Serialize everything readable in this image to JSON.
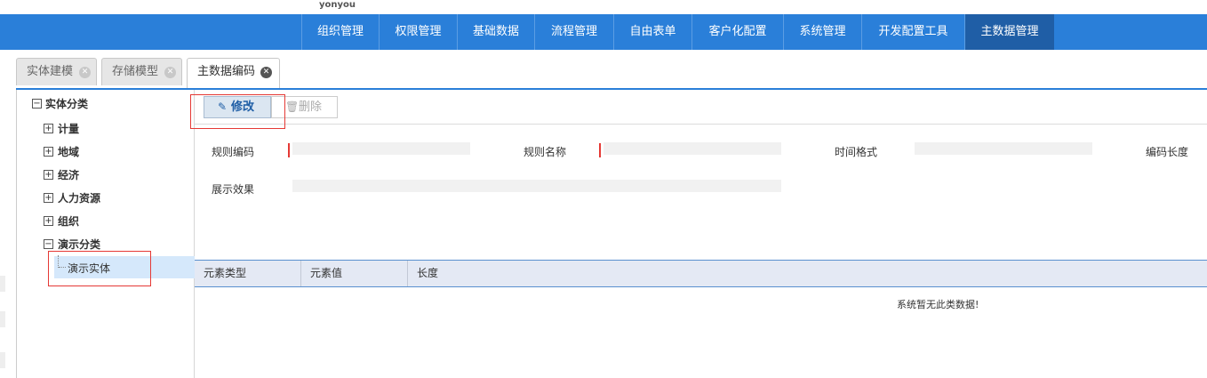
{
  "brand": {
    "logo_text": "yonyou"
  },
  "nav": {
    "items": [
      {
        "label": "组织管理"
      },
      {
        "label": "权限管理"
      },
      {
        "label": "基础数据"
      },
      {
        "label": "流程管理"
      },
      {
        "label": "自由表单"
      },
      {
        "label": "客户化配置"
      },
      {
        "label": "系统管理"
      },
      {
        "label": "开发配置工具"
      },
      {
        "label": "主数据管理",
        "active": true
      }
    ],
    "color": "#2a7fd9",
    "active_color": "#1f5ea6"
  },
  "tabs": [
    {
      "label": "实体建模",
      "close_icon": "close-circle-icon"
    },
    {
      "label": "存储模型",
      "close_icon": "close-circle-icon"
    },
    {
      "label": "主数据编码",
      "close_icon": "close-circle-icon",
      "active": true
    }
  ],
  "tree": {
    "root": {
      "label": "实体分类",
      "toggle": "−"
    },
    "nodes": [
      {
        "label": "计量",
        "toggle": "+"
      },
      {
        "label": "地域",
        "toggle": "+"
      },
      {
        "label": "经济",
        "toggle": "+"
      },
      {
        "label": "人力资源",
        "toggle": "+"
      },
      {
        "label": "组织",
        "toggle": "+"
      },
      {
        "label": "演示分类",
        "toggle": "−"
      }
    ],
    "selected_leaf": {
      "label": "演示实体"
    }
  },
  "toolbar": {
    "edit_label": "修改",
    "delete_label": "删除"
  },
  "form": {
    "rule_code_label": "规则编码",
    "rule_name_label": "规则名称",
    "time_format_label": "时间格式",
    "code_length_label": "编码长度",
    "preview_label": "展示效果"
  },
  "grid": {
    "columns": [
      "元素类型",
      "元素值",
      "长度"
    ],
    "empty_message": "系统暂无此类数据!"
  },
  "colors": {
    "highlight_box": "#e53935",
    "selected_row": "#d5e8fb"
  }
}
